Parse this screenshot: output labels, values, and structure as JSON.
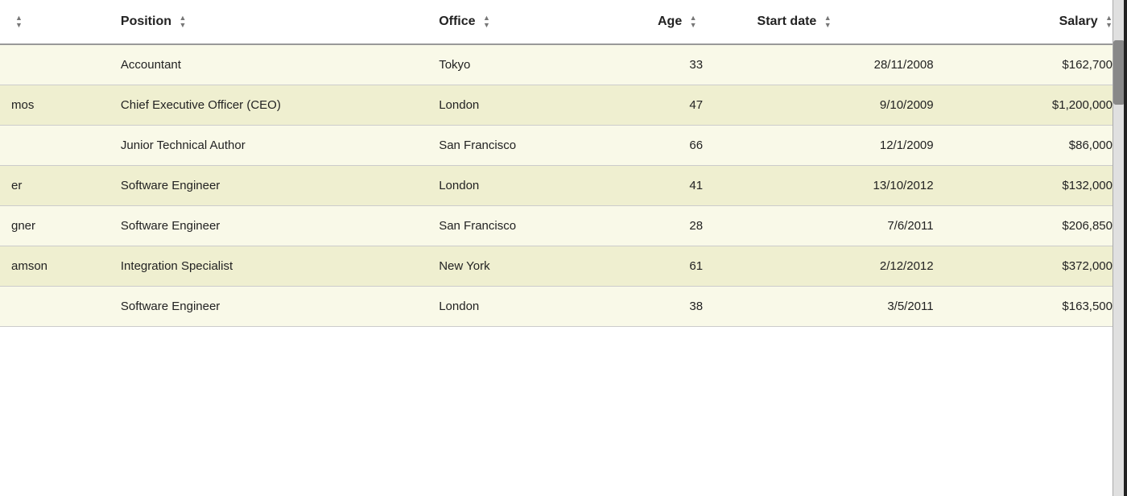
{
  "table": {
    "columns": [
      {
        "key": "name",
        "label": "",
        "sortable": true
      },
      {
        "key": "position",
        "label": "Position",
        "sortable": true
      },
      {
        "key": "office",
        "label": "Office",
        "sortable": true
      },
      {
        "key": "age",
        "label": "Age",
        "sortable": true
      },
      {
        "key": "startdate",
        "label": "Start date",
        "sortable": true
      },
      {
        "key": "salary",
        "label": "Salary",
        "sortable": true
      }
    ],
    "rows": [
      {
        "name": "",
        "position": "Accountant",
        "office": "Tokyo",
        "age": "33",
        "startdate": "28/11/2008",
        "salary": "$162,700"
      },
      {
        "name": "mos",
        "position": "Chief Executive Officer (CEO)",
        "office": "London",
        "age": "47",
        "startdate": "9/10/2009",
        "salary": "$1,200,000"
      },
      {
        "name": "",
        "position": "Junior Technical Author",
        "office": "San Francisco",
        "age": "66",
        "startdate": "12/1/2009",
        "salary": "$86,000"
      },
      {
        "name": "er",
        "position": "Software Engineer",
        "office": "London",
        "age": "41",
        "startdate": "13/10/2012",
        "salary": "$132,000"
      },
      {
        "name": "gner",
        "position": "Software Engineer",
        "office": "San Francisco",
        "age": "28",
        "startdate": "7/6/2011",
        "salary": "$206,850"
      },
      {
        "name": "amson",
        "position": "Integration Specialist",
        "office": "New York",
        "age": "61",
        "startdate": "2/12/2012",
        "salary": "$372,000"
      },
      {
        "name": "",
        "position": "Software Engineer",
        "office": "London",
        "age": "38",
        "startdate": "3/5/2011",
        "salary": "$163,500"
      }
    ]
  }
}
